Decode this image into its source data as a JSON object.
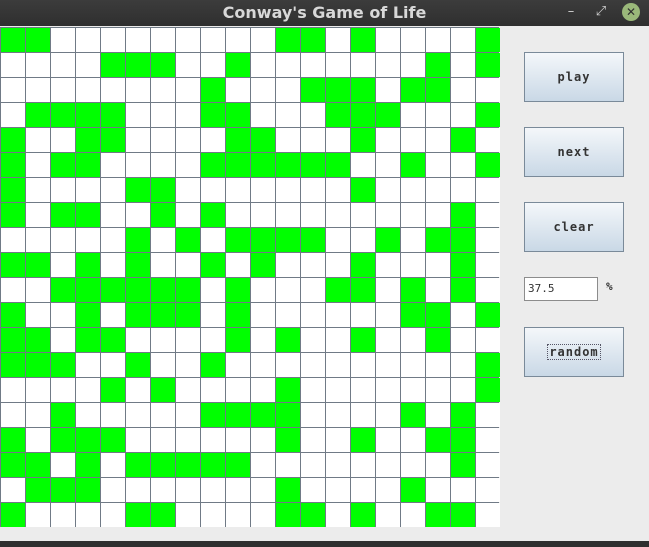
{
  "window": {
    "title": "Conway's Game of Life",
    "controls": {
      "minimize": "–",
      "maximize": "⤢",
      "close": "✕"
    }
  },
  "controls": {
    "play_label": "play",
    "next_label": "next",
    "clear_label": "clear",
    "random_label": "random",
    "density_value": "37.5",
    "density_unit": "%"
  },
  "colors": {
    "alive": "#00ff00",
    "dead": "#ffffff",
    "grid_line": "#707a86"
  },
  "grid": {
    "rows": 20,
    "cols": 20,
    "cells": [
      "11000000000110100001",
      "00001110010000000101",
      "00000000100011101100",
      "01111000110001110001",
      "10011000011000100010",
      "10110000111111001001",
      "10000110000000100000",
      "10110010100000000010",
      "00000101011110010110",
      "11010100101000100010",
      "00111111010001101010",
      "10010111010000001101",
      "11011000010100100100",
      "11100100100000000001",
      "00001010000100000001",
      "00100000111100001010",
      "10111000000100100110",
      "11010111110000000010",
      "01110000000100001000",
      "10000110000110100110"
    ]
  }
}
